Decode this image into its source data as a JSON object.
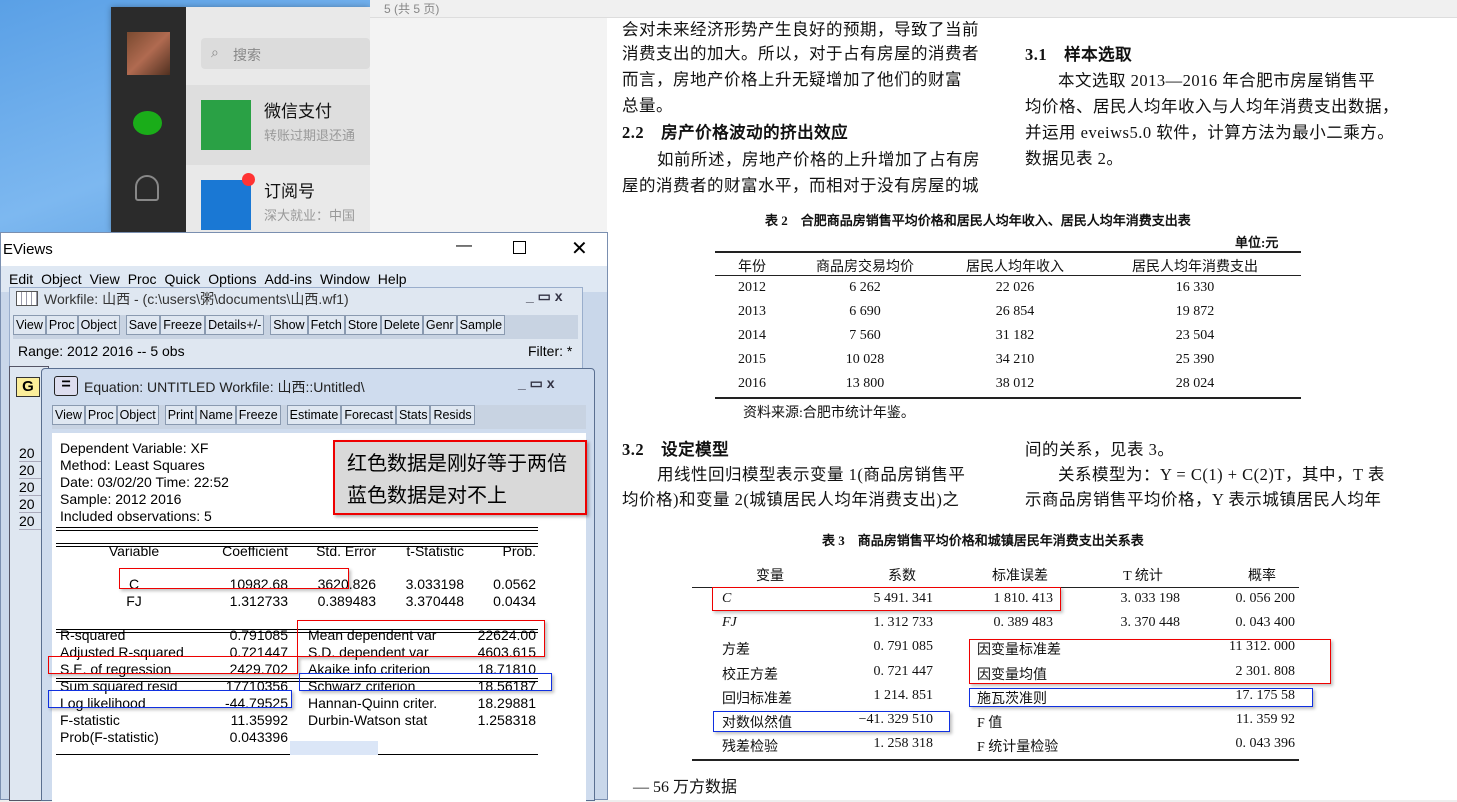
{
  "wechat": {
    "search_placeholder": "搜索",
    "chats": [
      {
        "title": "微信支付",
        "subtitle": "转账过期退还通"
      },
      {
        "title": "订阅号",
        "subtitle": "深大就业：中国"
      }
    ]
  },
  "viewer": {
    "toolbar_left": "5  (共 5 页)"
  },
  "document": {
    "left_col": [
      "会对未来经济形势产生良好的预期，导致了当前",
      "消费支出的加大。所以，对于占有房屋的消费者",
      "而言，房地产价格上升无疑增加了他们的财富",
      "总量。"
    ],
    "section_2_2": "2.2　房产价格波动的挤出效应",
    "left_col2": [
      "如前所述，房地产价格的上升增加了占有房",
      "屋的消费者的财富水平，而相对于没有房屋的城"
    ],
    "section_3_1": "3.1　样本选取",
    "right_col": [
      "本文选取 2013—2016 年合肥市房屋销售平",
      "均价格、居民人均年收入与人均年消费支出数据，",
      "并运用 eveiws5.0 软件，计算方法为最小二乘方。",
      "数据见表 2。"
    ],
    "table2": {
      "title": "表 2　合肥商品房销售平均价格和居民人均年收入、居民人均年消费支出表",
      "unit": "单位:元",
      "headers": [
        "年份",
        "商品房交易均价",
        "居民人均年收入",
        "居民人均年消费支出"
      ],
      "rows": [
        [
          "2012",
          "6 262",
          "22 026",
          "16 330"
        ],
        [
          "2013",
          "6 690",
          "26 854",
          "19 872"
        ],
        [
          "2014",
          "7 560",
          "31 182",
          "23 504"
        ],
        [
          "2015",
          "10 028",
          "34 210",
          "25 390"
        ],
        [
          "2016",
          "13 800",
          "38 012",
          "28 024"
        ]
      ],
      "source": "资料来源:合肥市统计年鉴。"
    },
    "section_3_2": "3.2　设定模型",
    "left_col3": [
      "用线性回归模型表示变量 1(商品房销售平",
      "均价格)和变量 2(城镇居民人均年消费支出)之"
    ],
    "right_col3": [
      "间的关系，见表 3。",
      "关系模型为：Y = C(1) + C(2)T，其中，T 表",
      "示商品房销售平均价格，Y 表示城镇居民人均年"
    ],
    "table3": {
      "title": "表 3　商品房销售平均价格和城镇居民年消费支出关系表",
      "headers": [
        "变量",
        "系数",
        "标准误差",
        "T 统计",
        "概率"
      ],
      "rows": [
        [
          "C",
          "5 491. 341",
          "1 810. 413",
          "3. 033 198",
          "0. 056 200"
        ],
        [
          "FJ",
          "1. 312 733",
          "0. 389 483",
          "3. 370 448",
          "0. 043 400"
        ],
        [
          "方差",
          "0. 791 085",
          "因变量标准差",
          "",
          "11 312. 000"
        ],
        [
          "校正方差",
          "0. 721 447",
          "因变量均值",
          "",
          "2 301. 808"
        ],
        [
          "回归标准差",
          "1 214. 851",
          "施瓦茨准则",
          "",
          "17. 175 58"
        ],
        [
          "对数似然值",
          "−41. 329 510",
          "F 值",
          "",
          "11. 359 92"
        ],
        [
          "残差检验",
          "1. 258 318",
          "F 统计量检验",
          "",
          "0. 043 396"
        ]
      ]
    },
    "footer": "— 56 万方数据"
  },
  "eviews": {
    "title": "EViews",
    "menu": [
      "Edit",
      "Object",
      "View",
      "Proc",
      "Quick",
      "Options",
      "Add-ins",
      "Window",
      "Help"
    ],
    "workfile": {
      "title": "Workfile: 山西 - (c:\\users\\粥\\documents\\山西.wf1)",
      "buttons": [
        "View",
        "Proc",
        "Object",
        "Save",
        "Freeze",
        "Details+/-",
        "Show",
        "Fetch",
        "Store",
        "Delete",
        "Genr",
        "Sample"
      ],
      "range": "Range:   2012 2016   --    5 obs",
      "filter": "Filter: *",
      "rows": [
        "20",
        "20",
        "20",
        "20",
        "20"
      ]
    },
    "equation": {
      "title": "Equation: UNTITLED   Workfile: 山西::Untitled\\",
      "buttons": [
        "View",
        "Proc",
        "Object",
        "Print",
        "Name",
        "Freeze",
        "Estimate",
        "Forecast",
        "Stats",
        "Resids"
      ],
      "header": [
        "Dependent Variable: XF",
        "Method: Least Squares",
        "Date: 03/02/20   Time: 22:52",
        "Sample: 2012 2016",
        "Included observations: 5"
      ],
      "columns": [
        "Variable",
        "Coefficient",
        "Std. Error",
        "t-Statistic",
        "Prob."
      ],
      "coefs": [
        [
          "C",
          "10982.68",
          "3620.826",
          "3.033198",
          "0.0562"
        ],
        [
          "FJ",
          "1.312733",
          "0.389483",
          "3.370448",
          "0.0434"
        ]
      ],
      "stats_left": [
        [
          "R-squared",
          "0.791085"
        ],
        [
          "Adjusted R-squared",
          "0.721447"
        ],
        [
          "S.E. of regression",
          "2429.702"
        ],
        [
          "Sum squared resid",
          "17710356"
        ],
        [
          "Log likelihood",
          "-44.79525"
        ],
        [
          "F-statistic",
          "11.35992"
        ],
        [
          "Prob(F-statistic)",
          "0.043396"
        ]
      ],
      "stats_right": [
        [
          "Mean dependent var",
          "22624.00"
        ],
        [
          "S.D. dependent var",
          "4603.615"
        ],
        [
          "Akaike info criterion",
          "18.71810"
        ],
        [
          "Schwarz criterion",
          "18.56187"
        ],
        [
          "Hannan-Quinn criter.",
          "18.29881"
        ],
        [
          "Durbin-Watson stat",
          "1.258318"
        ]
      ]
    }
  },
  "annotation": [
    "红色数据是刚好等于两倍",
    "蓝色数据是对不上"
  ],
  "colors": {
    "red_box": "#e00000",
    "blue_box": "#1030e0"
  }
}
